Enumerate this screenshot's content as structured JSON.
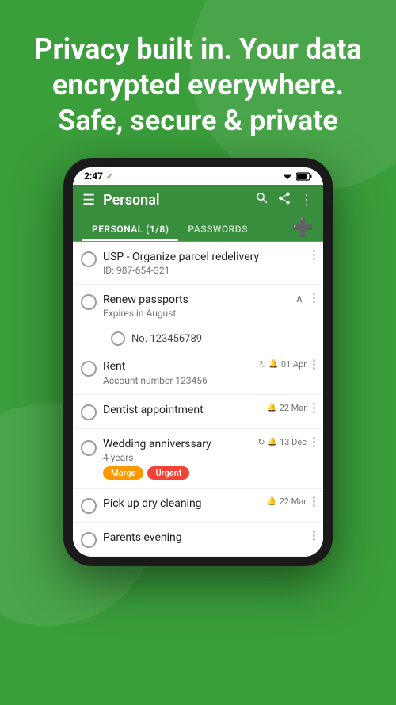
{
  "hero": {
    "text": "Privacy built in. Your data encrypted everywhere.\nSafe, secure & private"
  },
  "status_bar": {
    "time": "2:47",
    "check": "✓"
  },
  "toolbar": {
    "title": "Personal",
    "menu_icon": "☰",
    "search_icon": "🔍",
    "share_icon": "⬆",
    "more_icon": "⋮"
  },
  "tabs": [
    {
      "label": "PERSONAL (1/8)",
      "active": true
    },
    {
      "label": "PASSWORDS",
      "active": false
    }
  ],
  "list_items": [
    {
      "id": 1,
      "title": "USP - Organize parcel redelivery",
      "sub": "ID: 987-654-321",
      "date": null,
      "sync": false,
      "tags": [],
      "expanded": false
    },
    {
      "id": 2,
      "title": "Renew passports",
      "sub": "Expires in August",
      "date": null,
      "sync": false,
      "tags": [],
      "expanded": true,
      "sub_items": [
        {
          "text": "No. 123456789"
        }
      ]
    },
    {
      "id": 3,
      "title": "Rent",
      "sub": "Account number 123456",
      "date": "01 Apr",
      "sync": true,
      "bell": true,
      "tags": []
    },
    {
      "id": 4,
      "title": "Dentist appointment",
      "sub": null,
      "date": "22 Mar",
      "sync": false,
      "bell": true,
      "tags": []
    },
    {
      "id": 5,
      "title": "Wedding anniverssary",
      "sub": "4 years",
      "date": "13 Dec",
      "sync": true,
      "bell": true,
      "tags": [
        {
          "label": "Marge",
          "type": "merge"
        },
        {
          "label": "Urgent",
          "type": "urgent"
        }
      ]
    },
    {
      "id": 6,
      "title": "Pick up dry cleaning",
      "sub": null,
      "date": "22 Mar",
      "sync": false,
      "bell": true,
      "tags": []
    },
    {
      "id": 7,
      "title": "Parents evening",
      "sub": null,
      "date": null,
      "sync": false,
      "tags": []
    }
  ],
  "colors": {
    "green_dark": "#388e3c",
    "green_light": "#4caf50",
    "green_bg": "#3a9e3a",
    "orange": "#ff9800",
    "red": "#f44336"
  }
}
